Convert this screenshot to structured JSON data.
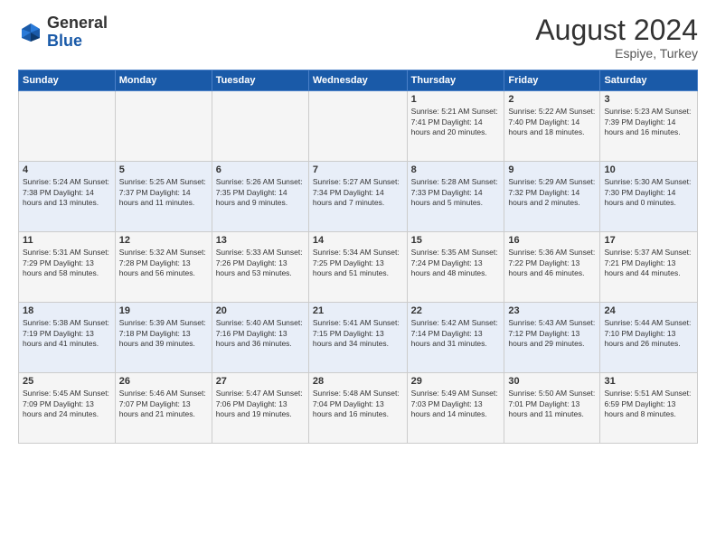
{
  "header": {
    "logo_general": "General",
    "logo_blue": "Blue",
    "month_year": "August 2024",
    "location": "Espiye, Turkey"
  },
  "days_of_week": [
    "Sunday",
    "Monday",
    "Tuesday",
    "Wednesday",
    "Thursday",
    "Friday",
    "Saturday"
  ],
  "weeks": [
    [
      {
        "day": "",
        "info": ""
      },
      {
        "day": "",
        "info": ""
      },
      {
        "day": "",
        "info": ""
      },
      {
        "day": "",
        "info": ""
      },
      {
        "day": "1",
        "info": "Sunrise: 5:21 AM\nSunset: 7:41 PM\nDaylight: 14 hours\nand 20 minutes."
      },
      {
        "day": "2",
        "info": "Sunrise: 5:22 AM\nSunset: 7:40 PM\nDaylight: 14 hours\nand 18 minutes."
      },
      {
        "day": "3",
        "info": "Sunrise: 5:23 AM\nSunset: 7:39 PM\nDaylight: 14 hours\nand 16 minutes."
      }
    ],
    [
      {
        "day": "4",
        "info": "Sunrise: 5:24 AM\nSunset: 7:38 PM\nDaylight: 14 hours\nand 13 minutes."
      },
      {
        "day": "5",
        "info": "Sunrise: 5:25 AM\nSunset: 7:37 PM\nDaylight: 14 hours\nand 11 minutes."
      },
      {
        "day": "6",
        "info": "Sunrise: 5:26 AM\nSunset: 7:35 PM\nDaylight: 14 hours\nand 9 minutes."
      },
      {
        "day": "7",
        "info": "Sunrise: 5:27 AM\nSunset: 7:34 PM\nDaylight: 14 hours\nand 7 minutes."
      },
      {
        "day": "8",
        "info": "Sunrise: 5:28 AM\nSunset: 7:33 PM\nDaylight: 14 hours\nand 5 minutes."
      },
      {
        "day": "9",
        "info": "Sunrise: 5:29 AM\nSunset: 7:32 PM\nDaylight: 14 hours\nand 2 minutes."
      },
      {
        "day": "10",
        "info": "Sunrise: 5:30 AM\nSunset: 7:30 PM\nDaylight: 14 hours\nand 0 minutes."
      }
    ],
    [
      {
        "day": "11",
        "info": "Sunrise: 5:31 AM\nSunset: 7:29 PM\nDaylight: 13 hours\nand 58 minutes."
      },
      {
        "day": "12",
        "info": "Sunrise: 5:32 AM\nSunset: 7:28 PM\nDaylight: 13 hours\nand 56 minutes."
      },
      {
        "day": "13",
        "info": "Sunrise: 5:33 AM\nSunset: 7:26 PM\nDaylight: 13 hours\nand 53 minutes."
      },
      {
        "day": "14",
        "info": "Sunrise: 5:34 AM\nSunset: 7:25 PM\nDaylight: 13 hours\nand 51 minutes."
      },
      {
        "day": "15",
        "info": "Sunrise: 5:35 AM\nSunset: 7:24 PM\nDaylight: 13 hours\nand 48 minutes."
      },
      {
        "day": "16",
        "info": "Sunrise: 5:36 AM\nSunset: 7:22 PM\nDaylight: 13 hours\nand 46 minutes."
      },
      {
        "day": "17",
        "info": "Sunrise: 5:37 AM\nSunset: 7:21 PM\nDaylight: 13 hours\nand 44 minutes."
      }
    ],
    [
      {
        "day": "18",
        "info": "Sunrise: 5:38 AM\nSunset: 7:19 PM\nDaylight: 13 hours\nand 41 minutes."
      },
      {
        "day": "19",
        "info": "Sunrise: 5:39 AM\nSunset: 7:18 PM\nDaylight: 13 hours\nand 39 minutes."
      },
      {
        "day": "20",
        "info": "Sunrise: 5:40 AM\nSunset: 7:16 PM\nDaylight: 13 hours\nand 36 minutes."
      },
      {
        "day": "21",
        "info": "Sunrise: 5:41 AM\nSunset: 7:15 PM\nDaylight: 13 hours\nand 34 minutes."
      },
      {
        "day": "22",
        "info": "Sunrise: 5:42 AM\nSunset: 7:14 PM\nDaylight: 13 hours\nand 31 minutes."
      },
      {
        "day": "23",
        "info": "Sunrise: 5:43 AM\nSunset: 7:12 PM\nDaylight: 13 hours\nand 29 minutes."
      },
      {
        "day": "24",
        "info": "Sunrise: 5:44 AM\nSunset: 7:10 PM\nDaylight: 13 hours\nand 26 minutes."
      }
    ],
    [
      {
        "day": "25",
        "info": "Sunrise: 5:45 AM\nSunset: 7:09 PM\nDaylight: 13 hours\nand 24 minutes."
      },
      {
        "day": "26",
        "info": "Sunrise: 5:46 AM\nSunset: 7:07 PM\nDaylight: 13 hours\nand 21 minutes."
      },
      {
        "day": "27",
        "info": "Sunrise: 5:47 AM\nSunset: 7:06 PM\nDaylight: 13 hours\nand 19 minutes."
      },
      {
        "day": "28",
        "info": "Sunrise: 5:48 AM\nSunset: 7:04 PM\nDaylight: 13 hours\nand 16 minutes."
      },
      {
        "day": "29",
        "info": "Sunrise: 5:49 AM\nSunset: 7:03 PM\nDaylight: 13 hours\nand 14 minutes."
      },
      {
        "day": "30",
        "info": "Sunrise: 5:50 AM\nSunset: 7:01 PM\nDaylight: 13 hours\nand 11 minutes."
      },
      {
        "day": "31",
        "info": "Sunrise: 5:51 AM\nSunset: 6:59 PM\nDaylight: 13 hours\nand 8 minutes."
      }
    ]
  ]
}
